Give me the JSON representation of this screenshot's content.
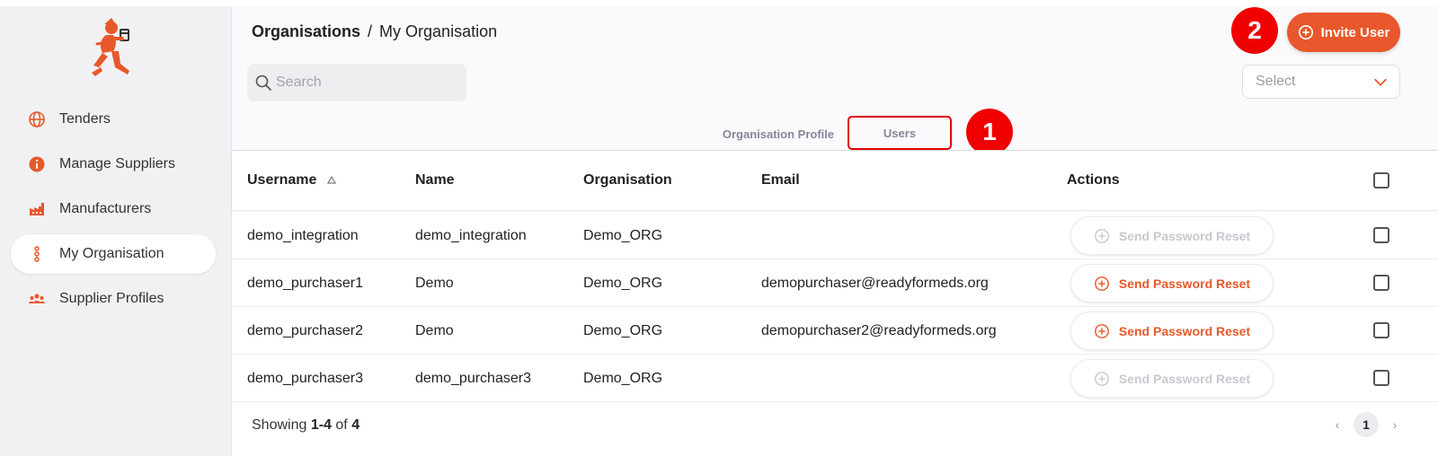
{
  "sidebar": {
    "items": [
      {
        "label": "Tenders",
        "icon": "globe-icon"
      },
      {
        "label": "Manage Suppliers",
        "icon": "info-icon"
      },
      {
        "label": "Manufacturers",
        "icon": "factory-icon"
      },
      {
        "label": "My Organisation",
        "icon": "dots-vertical-icon",
        "active": true
      },
      {
        "label": "Supplier Profiles",
        "icon": "users-group-icon"
      }
    ]
  },
  "header": {
    "breadcrumb_root": "Organisations",
    "breadcrumb_sep": "/",
    "breadcrumb_current": "My Organisation",
    "invite_label": "Invite User",
    "search_placeholder": "Search",
    "select_value": "Select"
  },
  "markers": {
    "one": "1",
    "two": "2"
  },
  "tabs": {
    "profile": "Organisation Profile",
    "users": "Users"
  },
  "table": {
    "headers": {
      "username": "Username",
      "name": "Name",
      "organisation": "Organisation",
      "email": "Email",
      "actions": "Actions"
    },
    "rows": [
      {
        "username": "demo_integration",
        "name": "demo_integration",
        "organisation": "Demo_ORG",
        "email": "",
        "action": "Send Password Reset",
        "action_enabled": false
      },
      {
        "username": "demo_purchaser1",
        "name": "Demo",
        "organisation": "Demo_ORG",
        "email": "demopurchaser@readyformeds.org",
        "action": "Send Password Reset",
        "action_enabled": true
      },
      {
        "username": "demo_purchaser2",
        "name": "Demo",
        "organisation": "Demo_ORG",
        "email": "demopurchaser2@readyformeds.org",
        "action": "Send Password Reset",
        "action_enabled": true
      },
      {
        "username": "demo_purchaser3",
        "name": "demo_purchaser3",
        "organisation": "Demo_ORG",
        "email": "",
        "action": "Send Password Reset",
        "action_enabled": false
      }
    ]
  },
  "footer": {
    "showing_prefix": "Showing",
    "showing_range": "1-4",
    "showing_of": "of",
    "showing_total": "4",
    "page": "1",
    "prev": "‹",
    "next": "›"
  },
  "colors": {
    "accent": "#e8582c",
    "marker": "#f00000"
  }
}
